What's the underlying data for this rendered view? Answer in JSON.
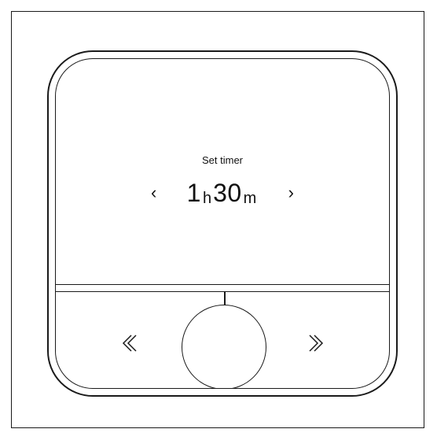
{
  "screen": {
    "title": "Set timer",
    "value": {
      "hours": "1",
      "hours_unit": "h",
      "minutes": "30",
      "minutes_unit": "m"
    },
    "prev_glyph": "‹",
    "next_glyph": "›"
  },
  "controls": {
    "left_icon": "double-chevron-left-icon",
    "right_icon": "double-chevron-right-icon",
    "center_icon": "circle-button"
  }
}
